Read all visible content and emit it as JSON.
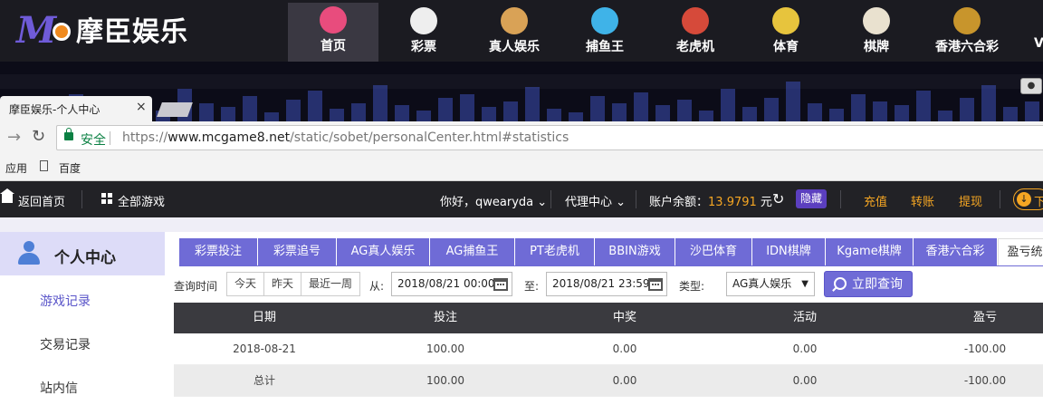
{
  "site": {
    "logo_text": "摩臣娱乐",
    "nav": [
      {
        "label": "首页",
        "icon": "home-icon",
        "color": "#e84c7d"
      },
      {
        "label": "彩票",
        "icon": "lottery-ball-icon",
        "color": "#eeeeee"
      },
      {
        "label": "真人娱乐",
        "icon": "video-play-icon",
        "color": "#d9a256"
      },
      {
        "label": "捕鱼王",
        "icon": "fish-icon",
        "color": "#3fb3e8"
      },
      {
        "label": "老虎机",
        "icon": "slot-machine-icon",
        "color": "#d64a3a"
      },
      {
        "label": "体育",
        "icon": "sports-icon",
        "color": "#e7c43d"
      },
      {
        "label": "棋牌",
        "icon": "playing-cards-icon",
        "color": "#e9e1cf"
      },
      {
        "label": "香港六合彩",
        "icon": "hk-lottery-icon",
        "color": "#c8952c"
      }
    ],
    "nav_overflow": "V"
  },
  "browser": {
    "tab_title": "摩臣娱乐-个人中心",
    "tab_close": "×",
    "secure_label": "安全",
    "url_scheme": "https://",
    "url_host": "www.mcgame8.net",
    "url_path": "/static/sobet/personalCenter.html#statistics",
    "bookmarks": [
      "应用",
      "百度"
    ]
  },
  "header": {
    "home": "返回首页",
    "all_games": "全部游戏",
    "greeting": "你好，qwearyda",
    "agent_center": "代理中心",
    "balance_label": "账户余额：",
    "balance_value": "13.9791",
    "balance_unit": "元",
    "hide": "隐藏",
    "deposit": "充值",
    "transfer": "转账",
    "withdraw": "提现",
    "download": "下"
  },
  "sidebar": {
    "title": "个人中心",
    "items": [
      "游戏记录",
      "交易记录",
      "站内信"
    ],
    "active_index": 0
  },
  "tabs": [
    "彩票投注",
    "彩票追号",
    "AG真人娱乐",
    "AG捕鱼王",
    "PT老虎机",
    "BBIN游戏",
    "沙巴体育",
    "IDN棋牌",
    "Kgame棋牌",
    "香港六合彩",
    "盈亏统"
  ],
  "query": {
    "label": "查询时间",
    "quick": [
      "今天",
      "昨天",
      "最近一周"
    ],
    "from_label": "从:",
    "from_value": "2018/08/21 00:00",
    "to_label": "至:",
    "to_value": "2018/08/21 23:59",
    "type_label": "类型:",
    "type_value": "AG真人娱乐",
    "submit": "立即查询"
  },
  "table": {
    "columns": [
      "日期",
      "投注",
      "中奖",
      "活动",
      "盈亏"
    ],
    "rows": [
      [
        "2018-08-21",
        "100.00",
        "0.00",
        "0.00",
        "-100.00"
      ],
      [
        "总计",
        "100.00",
        "0.00",
        "0.00",
        "-100.00"
      ]
    ]
  }
}
